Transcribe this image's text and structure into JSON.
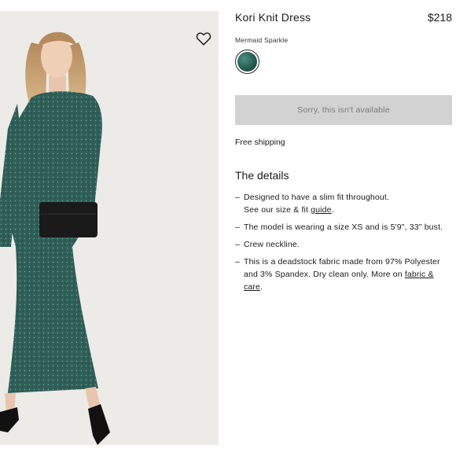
{
  "product": {
    "title": "Kori Knit Dress",
    "price": "$218",
    "color_name": "Mermaid Sparkle",
    "swatch_color": "#2f6a60",
    "availability_button": "Sorry, this isn't available",
    "shipping": "Free shipping"
  },
  "details": {
    "heading": "The details",
    "line1_a": "Designed to have a slim fit throughout.",
    "line1_b": "See our size & fit ",
    "line1_link": "guide",
    "line1_end": ".",
    "line2": "The model is wearing a size XS and is 5'9\", 33\" bust.",
    "line3": "Crew neckline.",
    "line4_a": "This is a deadstock fabric made from 97% Polyester and 3% Spandex. Dry clean only. More on ",
    "line4_link": "fabric & care",
    "line4_end": "."
  },
  "icons": {
    "favorite": "heart-outline-icon"
  },
  "colors": {
    "dress": "#2f5f57",
    "button_bg": "#d2d2d2",
    "button_text": "#7a7a7a",
    "photo_bg": "#ecebe8"
  }
}
